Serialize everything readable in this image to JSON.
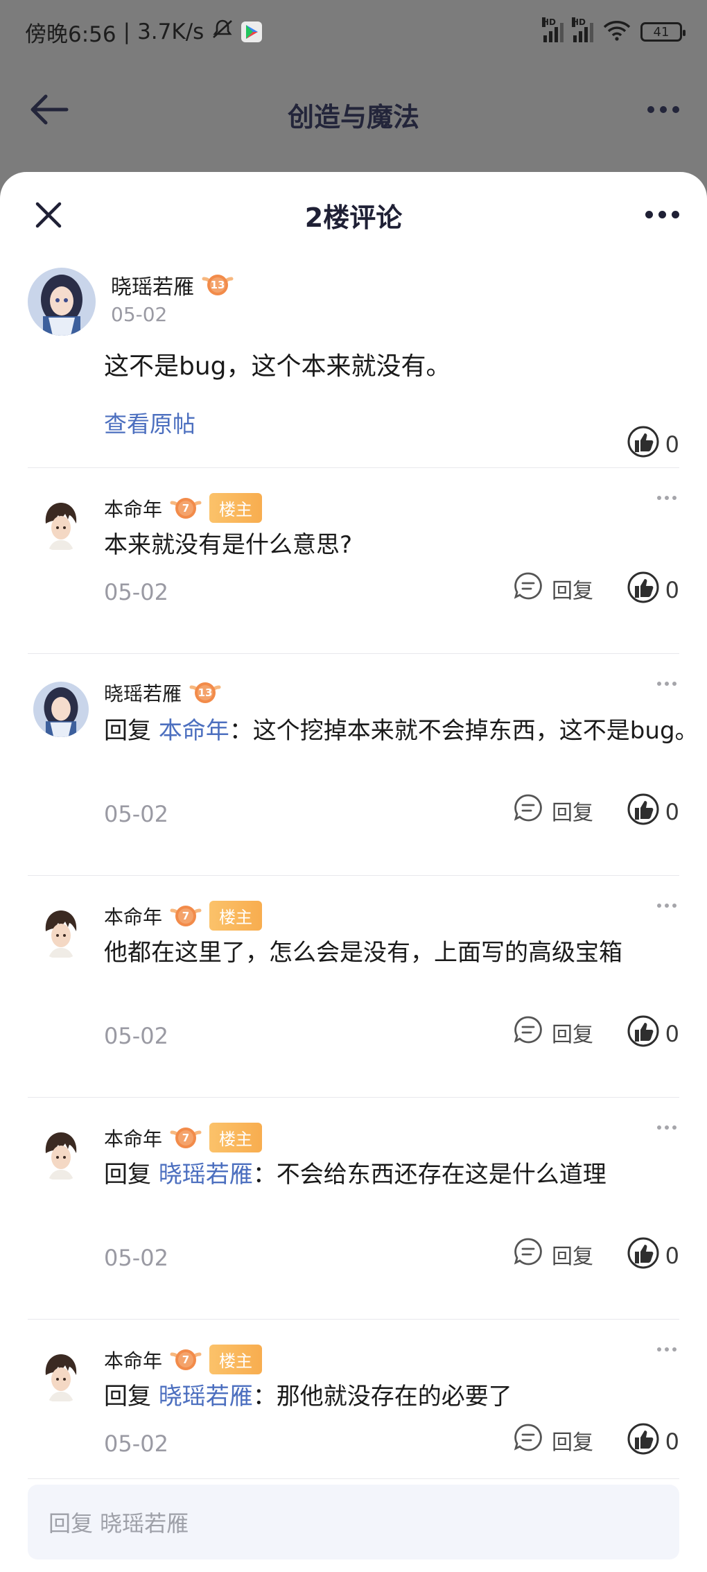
{
  "status_bar": {
    "time": "傍晚6:56",
    "speed": "3.7K/s",
    "signal_label": "HD",
    "battery": "41"
  },
  "background": {
    "title": "创造与魔法"
  },
  "sheet": {
    "title": "2楼评论"
  },
  "main_post": {
    "username": "晓瑶若雁",
    "level": "13",
    "date": "05-02",
    "text": "这不是bug，这个本来就没有。",
    "view_original": "查看原帖",
    "likes": "0"
  },
  "labels": {
    "reply": "回复",
    "host": "楼主",
    "reply_prefix": "回复"
  },
  "comments": [
    {
      "username": "本命年",
      "level": "7",
      "is_host": true,
      "reply_to": "",
      "text": "本来就没有是什么意思?",
      "date": "05-02",
      "likes": "0"
    },
    {
      "username": "晓瑶若雁",
      "level": "13",
      "is_host": false,
      "reply_to": "本命年",
      "text": "：这个挖掉本来就不会掉东西，这不是bug。",
      "date": "05-02",
      "likes": "0"
    },
    {
      "username": "本命年",
      "level": "7",
      "is_host": true,
      "reply_to": "",
      "text": "他都在这里了，怎么会是没有，上面写的高级宝箱",
      "date": "05-02",
      "likes": "0"
    },
    {
      "username": "本命年",
      "level": "7",
      "is_host": true,
      "reply_to": "晓瑶若雁",
      "text": "：不会给东西还存在这是什么道理",
      "date": "05-02",
      "likes": "0"
    },
    {
      "username": "本命年",
      "level": "7",
      "is_host": true,
      "reply_to": "晓瑶若雁",
      "text": "：那他就没存在的必要了",
      "date": "05-02",
      "likes": "0"
    }
  ],
  "reply_input": {
    "placeholder": "回复 晓瑶若雁"
  }
}
